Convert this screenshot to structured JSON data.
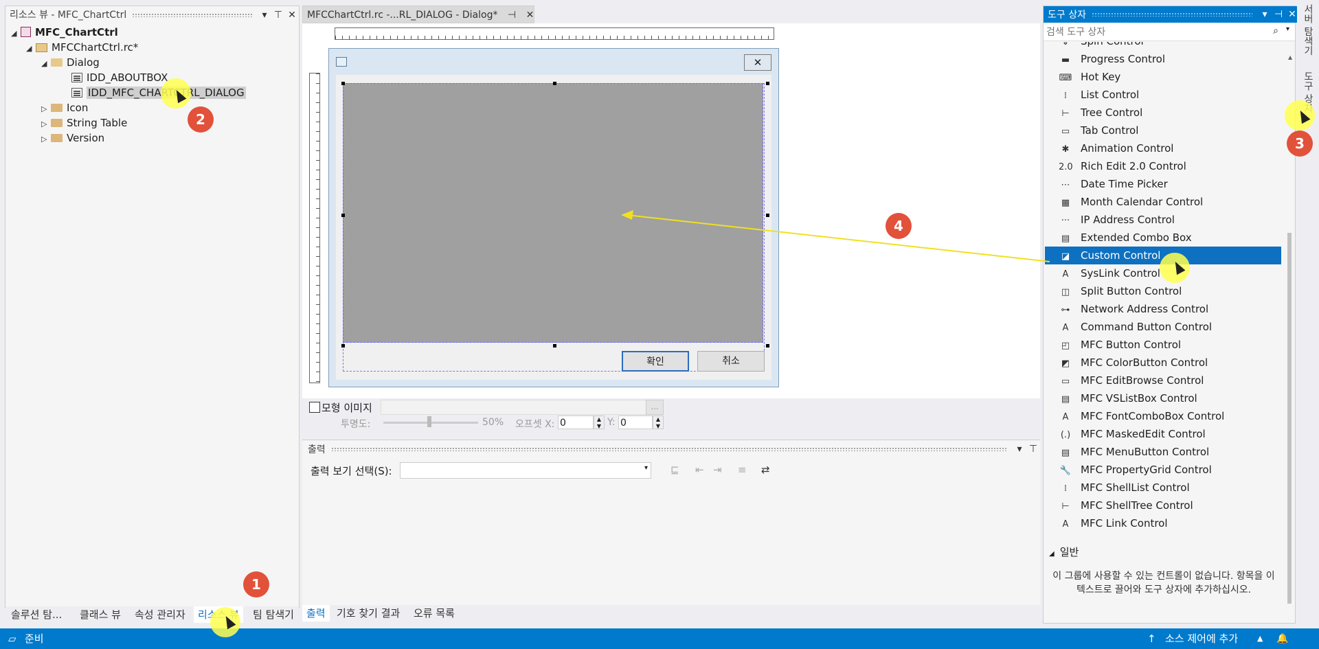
{
  "left_panel": {
    "title": "리소스 뷰 - MFC_ChartCtrl",
    "tree": {
      "project": "MFC_ChartCtrl",
      "rc_file": "MFCChartCtrl.rc*",
      "dialog_folder": "Dialog",
      "about_box": "IDD_ABOUTBOX",
      "main_dialog": "IDD_MFC_CHARTCTRL_DIALOG",
      "icon_folder": "Icon",
      "string_table": "String Table",
      "version_folder": "Version"
    },
    "tabs": [
      "솔루션 탐...",
      "클래스 뷰",
      "속성 관리자",
      "리소스 뷰",
      "팀 탐색기"
    ],
    "active_tab": "리소스 뷰"
  },
  "document_tab": {
    "title": "MFCChartCtrl.rc -...RL_DIALOG - Dialog*",
    "pin": "⊣",
    "close": "✕"
  },
  "dialog_preview": {
    "ok_label": "확인",
    "cancel_label": "취소",
    "close_glyph": "✕"
  },
  "image_toolbar": {
    "mockup_label": "모형 이미지",
    "mockup_checked": false,
    "browse_label": "...",
    "opacity_label": "투명도:",
    "opacity_value": "50%",
    "opacity_level": 0.5,
    "offset_label": "오프셋 X:",
    "offset_x": "0",
    "y_label": "Y:",
    "offset_y": "0"
  },
  "output_panel": {
    "title": "출력",
    "source_label": "출력 보기 선택(S):",
    "source_value": "",
    "tabs": [
      "출력",
      "기호 찾기 결과",
      "오류 목록"
    ],
    "active_tab": "출력"
  },
  "toolbox": {
    "title": "도구 상자",
    "search_placeholder": "검색 도구 상자",
    "items": [
      {
        "label": "Spin Control",
        "icon": "spin-icon",
        "glyph": "⇕"
      },
      {
        "label": "Progress Control",
        "icon": "progress-icon",
        "glyph": "▬"
      },
      {
        "label": "Hot Key",
        "icon": "hotkey-icon",
        "glyph": "⌨"
      },
      {
        "label": "List Control",
        "icon": "list-icon",
        "glyph": "⁞"
      },
      {
        "label": "Tree Control",
        "icon": "tree-icon",
        "glyph": "⊢"
      },
      {
        "label": "Tab Control",
        "icon": "tab-icon",
        "glyph": "▭"
      },
      {
        "label": "Animation Control",
        "icon": "animation-icon",
        "glyph": "✱"
      },
      {
        "label": "Rich Edit 2.0 Control",
        "icon": "richedit-icon",
        "glyph": "2.0"
      },
      {
        "label": "Date Time Picker",
        "icon": "datetime-icon",
        "glyph": "⋯"
      },
      {
        "label": "Month Calendar Control",
        "icon": "calendar-icon",
        "glyph": "▦"
      },
      {
        "label": "IP Address Control",
        "icon": "ipaddress-icon",
        "glyph": "···"
      },
      {
        "label": "Extended Combo Box",
        "icon": "combobox-icon",
        "glyph": "▤"
      },
      {
        "label": "Custom Control",
        "icon": "custom-control-icon",
        "glyph": "◪"
      },
      {
        "label": "SysLink Control",
        "icon": "syslink-icon",
        "glyph": "A"
      },
      {
        "label": "Split Button Control",
        "icon": "split-button-icon",
        "glyph": "◫"
      },
      {
        "label": "Network Address Control",
        "icon": "network-icon",
        "glyph": "⊶"
      },
      {
        "label": "Command Button Control",
        "icon": "command-button-icon",
        "glyph": "A"
      },
      {
        "label": "MFC Button Control",
        "icon": "mfc-button-icon",
        "glyph": "◰"
      },
      {
        "label": "MFC ColorButton Control",
        "icon": "color-button-icon",
        "glyph": "◩"
      },
      {
        "label": "MFC EditBrowse Control",
        "icon": "edit-browse-icon",
        "glyph": "▭"
      },
      {
        "label": "MFC VSListBox Control",
        "icon": "vslistbox-icon",
        "glyph": "▤"
      },
      {
        "label": "MFC FontComboBox Control",
        "icon": "font-combo-icon",
        "glyph": "A"
      },
      {
        "label": "MFC MaskedEdit Control",
        "icon": "masked-edit-icon",
        "glyph": "(.)"
      },
      {
        "label": "MFC MenuButton Control",
        "icon": "menu-button-icon",
        "glyph": "▤"
      },
      {
        "label": "MFC PropertyGrid Control",
        "icon": "property-grid-icon",
        "glyph": "🔧"
      },
      {
        "label": "MFC ShellList Control",
        "icon": "shell-list-icon",
        "glyph": "⁞"
      },
      {
        "label": "MFC ShellTree Control",
        "icon": "shell-tree-icon",
        "glyph": "⊢"
      },
      {
        "label": "MFC Link Control",
        "icon": "mfc-link-icon",
        "glyph": "A"
      }
    ],
    "selected_item": "Custom Control",
    "general_group": "일반",
    "empty_message": "이 그룹에 사용할 수 있는 컨트롤이 없습니다. 항목을 이 텍스트로 끌어와 도구 상자에 추가하십시오."
  },
  "side_tabs": [
    "서버 탐색기",
    "도구 상자"
  ],
  "status_bar": {
    "status": "준비",
    "source_control": "소스 제어에 추가",
    "bell": "🔔"
  },
  "annotations": {
    "steps": [
      "1",
      "2",
      "3",
      "4"
    ],
    "colors": {
      "badge": "#e2513a",
      "highlight": "#ffff50",
      "arrow": "#f0e020"
    }
  },
  "colors": {
    "accent": "#007acc",
    "selection": "#0e70c0"
  }
}
